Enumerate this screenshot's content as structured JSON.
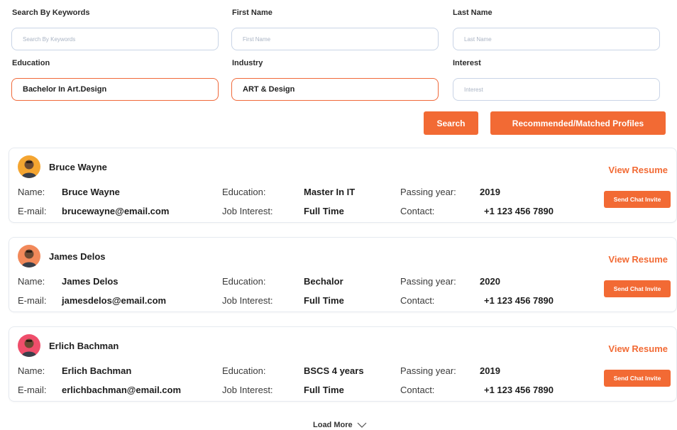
{
  "filters": {
    "keywords": {
      "label": "Search By Keywords",
      "placeholder": "Search By Keywords",
      "value": ""
    },
    "first_name": {
      "label": "First Name",
      "placeholder": "First Name",
      "value": ""
    },
    "last_name": {
      "label": "Last Name",
      "placeholder": "Last Name",
      "value": ""
    },
    "education": {
      "label": "Education",
      "placeholder": "",
      "value": "Bachelor In Art.Design"
    },
    "industry": {
      "label": "Industry",
      "placeholder": "",
      "value": "ART & Design"
    },
    "interest": {
      "label": "Interest",
      "placeholder": "Interest",
      "value": ""
    }
  },
  "actions": {
    "search_label": "Search",
    "recommended_label": "Recommended/Matched Profiles"
  },
  "field_labels": {
    "name": "Name:",
    "email": "E-mail:",
    "education": "Education:",
    "job_interest": "Job Interest:",
    "passing_year": "Passing year:",
    "contact": "Contact:"
  },
  "profiles": [
    {
      "name": "Bruce Wayne",
      "email": "brucewayne@email.com",
      "education": "Master In IT",
      "job_interest": "Full Time",
      "passing_year": "2019",
      "contact": "+1 123 456 7890",
      "avatar_bg": "#f4a531"
    },
    {
      "name": "James Delos",
      "email": "jamesdelos@email.com",
      "education": "Bechalor",
      "job_interest": "Full Time",
      "passing_year": "2020",
      "contact": "+1 123 456 7890",
      "avatar_bg": "#f2895a"
    },
    {
      "name": "Erlich Bachman",
      "email": "erlichbachman@email.com",
      "education": "BSCS 4 years",
      "job_interest": "Full Time",
      "passing_year": "2019",
      "contact": "+1 123 456 7890",
      "avatar_bg": "#ef4e6b"
    }
  ],
  "card_actions": {
    "view_resume": "View Resume",
    "send_chat_invite": "Send Chat Invite"
  },
  "load_more": "Load More",
  "colors": {
    "accent": "#f26a34",
    "input_border": "#c9d4e6"
  }
}
